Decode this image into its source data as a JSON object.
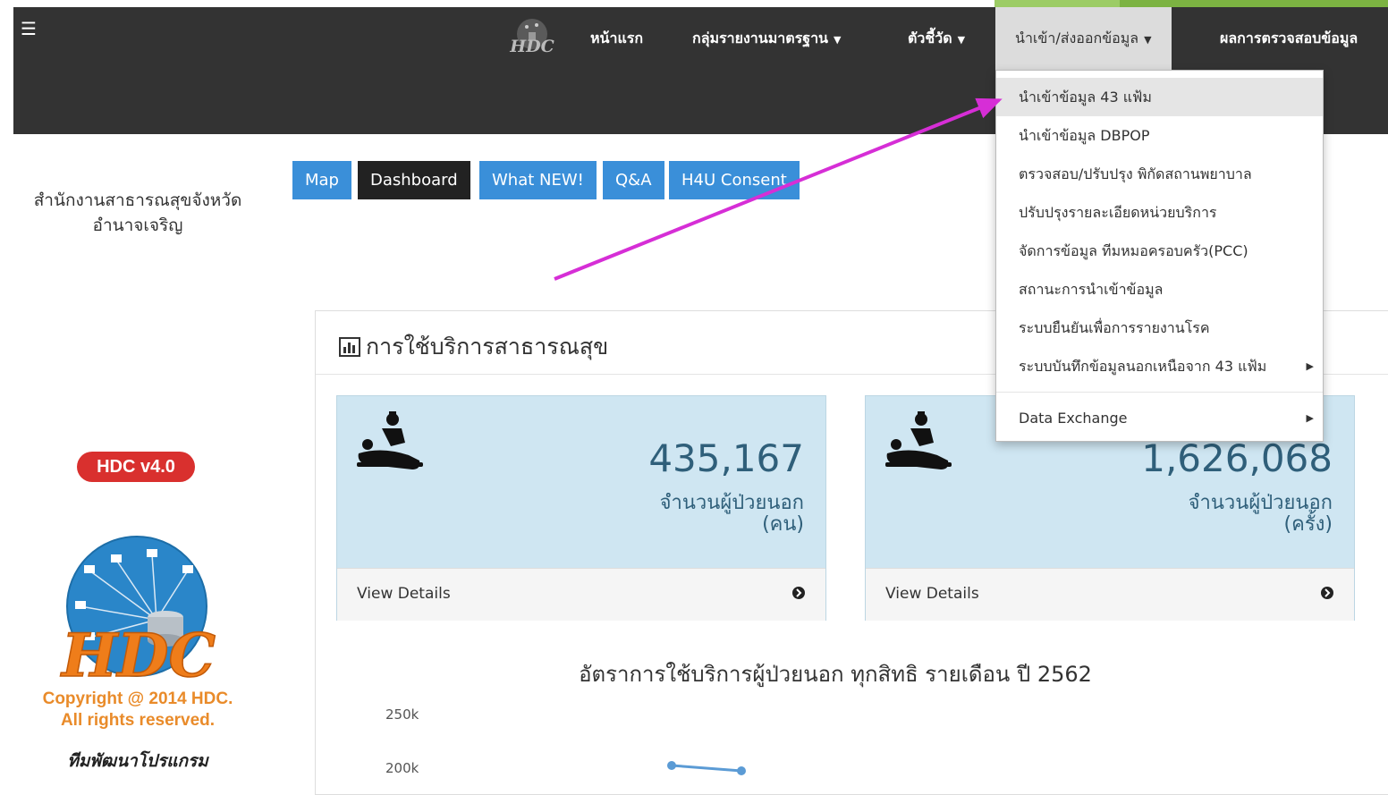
{
  "navbar": {
    "menu_icon": "hamburger-icon",
    "logo_text": "HDC",
    "items": [
      {
        "label": "หน้าแรก",
        "caret": false
      },
      {
        "label": "กลุ่มรายงานมาตรฐาน",
        "caret": true
      },
      {
        "label": "ตัวชี้วัด",
        "caret": true
      },
      {
        "label": "นำเข้า/ส่งออกข้อมูล",
        "caret": true,
        "active": true
      },
      {
        "label": "ผลการตรวจสอบข้อมูล",
        "caret": false
      }
    ]
  },
  "dropdown": {
    "items": [
      {
        "label": "นำเข้าข้อมูล 43 แฟ้ม",
        "highlighted": true
      },
      {
        "label": "นำเข้าข้อมูล DBPOP"
      },
      {
        "label": "ตรวจสอบ/ปรับปรุง พิกัดสถานพยาบาล"
      },
      {
        "label": "ปรับปรุงรายละเอียดหน่วยบริการ"
      },
      {
        "label": "จัดการข้อมูล ทีมหมอครอบครัว(PCC)"
      },
      {
        "label": "สถานะการนำเข้าข้อมูล"
      },
      {
        "label": "ระบบยืนยันเพื่อการรายงานโรค"
      },
      {
        "label": "ระบบบันทึกข้อมูลนอกเหนือจาก 43 แฟ้ม",
        "submenu": true
      },
      {
        "label": "Data Exchange",
        "submenu": true
      }
    ]
  },
  "sidebar": {
    "org_line1": "สำนักงานสาธารณสุขจังหวัด",
    "org_line2": "อำนาจเจริญ",
    "version_badge": "HDC v4.0",
    "logo_text": "HDC",
    "copyright_line1": "Copyright @ 2014 HDC.",
    "copyright_line2": "All rights reserved.",
    "team": "ทีมพัฒนาโปรแกรม"
  },
  "buttons": [
    "Map",
    "Dashboard",
    "What NEW!",
    "Q&A",
    "H4U Consent"
  ],
  "panel": {
    "title": "การใช้บริการสาธารณสุข",
    "title_icon": "bar-chart-icon",
    "stats": [
      {
        "value": "435,167",
        "label_line1": "จำนวนผู้ป่วยนอก",
        "label_line2": "(คน)",
        "footer": "View Details",
        "icon": "doctor-patient-icon"
      },
      {
        "value": "1,626,068",
        "label_line1": "จำนวนผู้ป่วยนอก",
        "label_line2": "(ครั้ง)",
        "footer": "View Details",
        "icon": "doctor-patient-icon"
      }
    ],
    "chart_title": "อัตราการใช้บริการผู้ป่วยนอก ทุกสิทธิ รายเดือน ปี 2562",
    "y_ticks": [
      "250k",
      "200k"
    ]
  },
  "colors": {
    "navbar_bg": "#333333",
    "stat_bg": "#cfe6f2",
    "button_blue": "#3a8fd9",
    "button_dark": "#222222",
    "badge_red": "#d9302e",
    "annotation_arrow": "#d62ed6"
  }
}
